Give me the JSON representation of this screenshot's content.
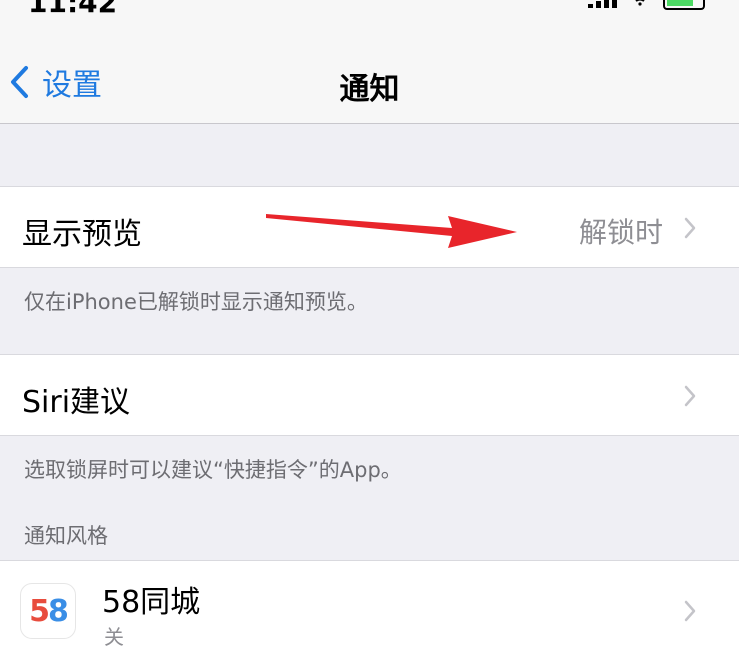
{
  "status_bar": {
    "time": "11:42"
  },
  "nav": {
    "back_label": "设置",
    "title": "通知"
  },
  "show_preview": {
    "label": "显示预览",
    "value": "解锁时",
    "footnote": "仅在iPhone已解锁时显示通知预览。"
  },
  "siri": {
    "label": "Siri建议",
    "footnote": "选取锁屏时可以建议“快捷指令”的App。"
  },
  "notification_style": {
    "header": "通知风格"
  },
  "apps": [
    {
      "name": "58同城",
      "status": "关",
      "logo_text_1": "5",
      "logo_text_2": "8"
    }
  ],
  "colors": {
    "accent": "#1f7ae0",
    "arrow": "#e8252b",
    "background": "#efeff4"
  },
  "icons": [
    "back-chevron-icon",
    "chevron-right-icon",
    "wifi-icon",
    "battery-icon",
    "signal-icon",
    "location-arrow-icon"
  ]
}
